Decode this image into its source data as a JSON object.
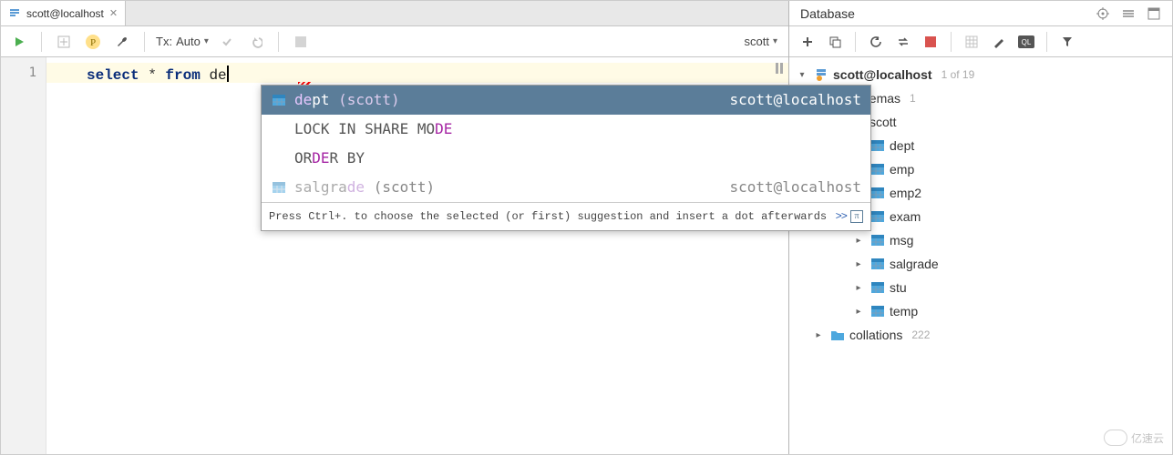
{
  "tab": {
    "title": "scott@localhost"
  },
  "toolbar": {
    "tx_label": "Tx:",
    "tx_mode": "Auto",
    "connection": "scott"
  },
  "editor": {
    "line_number": "1",
    "sql_select": "select",
    "sql_star": " * ",
    "sql_from": "from",
    "sql_space": " ",
    "sql_typed": "de"
  },
  "autocomplete": {
    "items": [
      {
        "pre": "de",
        "post": "pt",
        "paren": " (scott)",
        "right": "scott@localhost",
        "selected": true,
        "hasTableIcon": true
      },
      {
        "pre_plain": "LOCK IN SHARE MO",
        "hl": "DE",
        "post_plain": "",
        "right": "",
        "selected": false,
        "hasTableIcon": false
      },
      {
        "pre_plain": "OR",
        "hl": "DE",
        "post_plain": "R BY",
        "right": "",
        "selected": false,
        "hasTableIcon": false
      },
      {
        "disabled": true,
        "pre_dis": "salgra",
        "hl_dis": "de",
        "paren_dis": " (scott)",
        "right": "scott@localhost",
        "hasTableIcon": true
      }
    ],
    "hint_text": "Press Ctrl+. to choose the selected (or first) suggestion and insert a dot afterwards",
    "hint_more": ">>"
  },
  "database_panel": {
    "title": "Database",
    "root": {
      "label": "scott@localhost",
      "meta": "1 of 19"
    },
    "schemas_label": "schemas",
    "schemas_meta": "1",
    "schema_name": "scott",
    "tables": [
      "dept",
      "emp",
      "emp2",
      "exam",
      "msg",
      "salgrade",
      "stu",
      "temp"
    ],
    "collations_label": "collations",
    "collations_meta": "222"
  },
  "watermark": "亿速云"
}
